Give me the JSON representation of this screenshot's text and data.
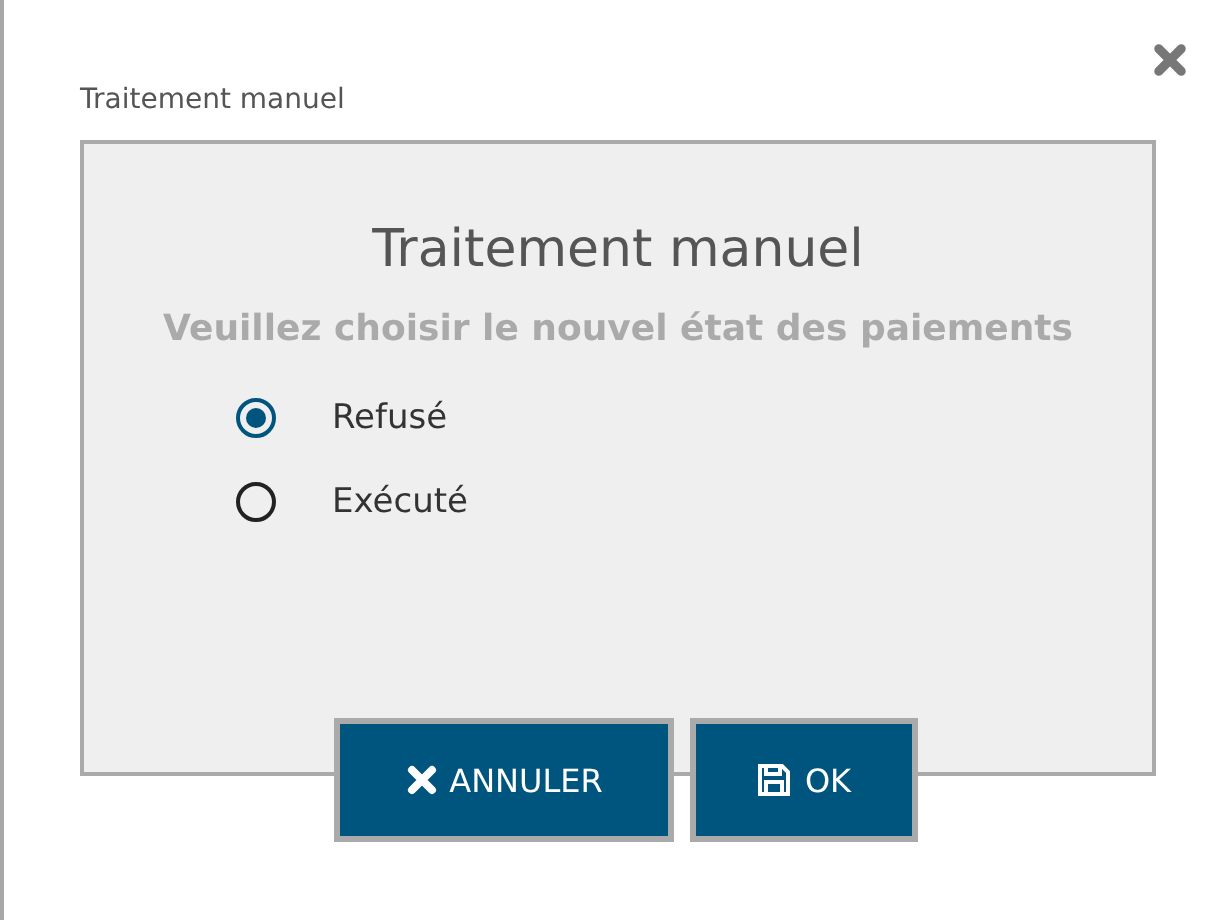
{
  "dialog": {
    "title": "Traitement manuel"
  },
  "panel": {
    "heading": "Traitement manuel",
    "subtitle": "Veuillez choisir le nouvel état des paiements"
  },
  "options": [
    {
      "label": "Refusé",
      "selected": true
    },
    {
      "label": "Exécuté",
      "selected": false
    }
  ],
  "buttons": [
    {
      "kind": "cancel",
      "label": "ANNULER"
    },
    {
      "kind": "save",
      "label": "OK"
    }
  ]
}
